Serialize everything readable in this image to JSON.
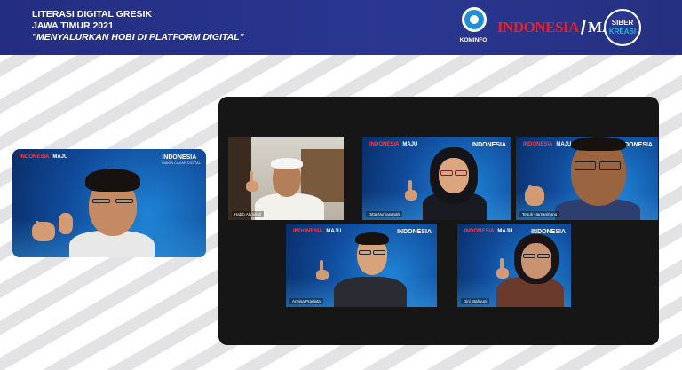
{
  "banner": {
    "line1": "LITERASI DIGITAL GRESIK",
    "line2": "JAWA TIMUR 2021",
    "line3": "\"MENYALURKAN HOBI DI PLATFORM DIGITAL\"",
    "kominfo_label": "KOMINFO",
    "indonesia_logo": "INDONESIA",
    "maju_logo": "MAJU",
    "siber_top": "SIBER",
    "siber_bottom": "KREASI"
  },
  "background_text": {
    "title": "INDONESIA",
    "subtitle": "MAKIN CAKAP DIGITAL"
  },
  "participants": [
    {
      "id": "host",
      "name": ""
    },
    {
      "id": "p1",
      "name": "Habib Abdullah"
    },
    {
      "id": "p2",
      "name": "Ditta Nurhasanah"
    },
    {
      "id": "p3",
      "name": "Teguh Harsambang"
    },
    {
      "id": "p4",
      "name": "Annisa Pradipta"
    },
    {
      "id": "p5",
      "name": "Dini Wahyuni"
    }
  ],
  "colors": {
    "banner": "#2a3791",
    "panel": "#161616",
    "tile_blue": "#114b9b",
    "brand_red": "#e5222a"
  }
}
